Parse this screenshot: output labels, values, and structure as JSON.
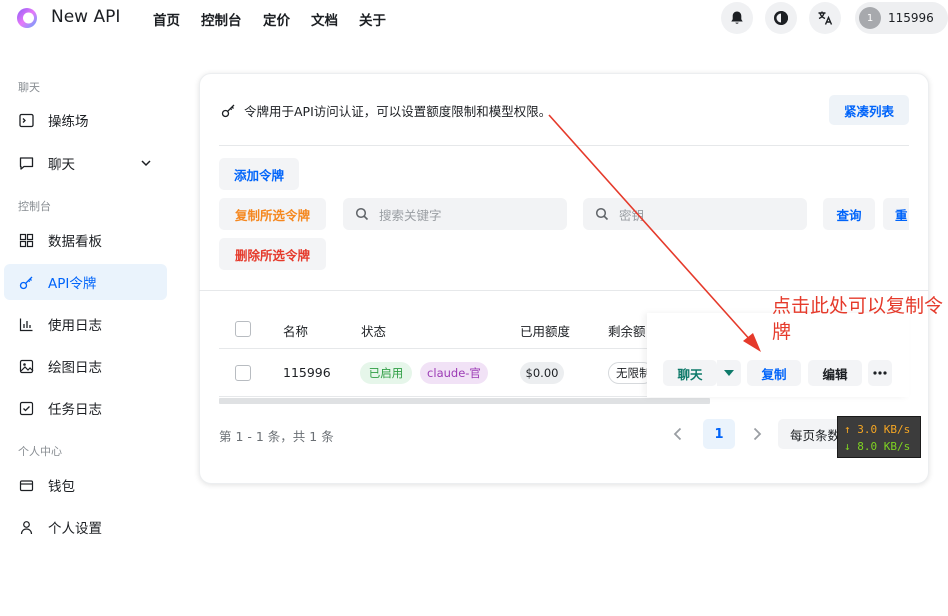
{
  "app": {
    "brand": "New API"
  },
  "nav": [
    "首页",
    "控制台",
    "定价",
    "文档",
    "关于"
  ],
  "topbar": {
    "icons": [
      "bell-icon",
      "theme-moon-icon",
      "language-translate-icon"
    ],
    "user": {
      "avatar_text": "1",
      "name": "115996"
    }
  },
  "sidebar": {
    "sections": [
      {
        "label": "聊天"
      },
      {
        "label": "控制台"
      },
      {
        "label": "个人中心"
      }
    ],
    "items": [
      {
        "label": "操练场",
        "icon": "terminal-icon"
      },
      {
        "label": "聊天",
        "icon": "chat-bubble-icon"
      },
      {
        "label": "数据看板",
        "icon": "dashboard-grid-icon"
      },
      {
        "label": "API令牌",
        "icon": "key-icon",
        "active": true
      },
      {
        "label": "使用日志",
        "icon": "bar-chart-icon"
      },
      {
        "label": "绘图日志",
        "icon": "image-icon"
      },
      {
        "label": "任务日志",
        "icon": "checklist-icon"
      },
      {
        "label": "钱包",
        "icon": "wallet-icon"
      },
      {
        "label": "个人设置",
        "icon": "user-icon"
      }
    ]
  },
  "main": {
    "info": "令牌用于API访问认证，可以设置额度限制和模型权限。",
    "compact_label": "紧凑列表",
    "add_token": "添加令牌",
    "copy_selected": "复制所选令牌",
    "delete_selected": "删除所选令牌",
    "search_keyword_placeholder": "搜索关键字",
    "search_key_placeholder": "密钥",
    "query": "查询",
    "reset": "重",
    "columns": [
      "名称",
      "状态",
      "已用额度",
      "剩余额"
    ],
    "rows": [
      {
        "name": "115996",
        "status": "已启用",
        "model": "claude-官",
        "used": "$0.00",
        "remaining": "无限制"
      }
    ],
    "row_actions": {
      "chat": "聊天",
      "copy": "复制",
      "edit": "编辑"
    },
    "pagination": {
      "summary": "第 1 - 1 条，共 1 条",
      "current": "1",
      "per_page": "每页条数:"
    }
  },
  "speed": {
    "up": "↑ 3.0 KB/s",
    "down": "↓ 8.0 KB/s"
  },
  "annotation": {
    "text": "点击此处可以复制令牌"
  },
  "colors": {
    "accent": "#0064fa",
    "orange": "#f5871f",
    "red": "#e53a2b",
    "green": "#2f9e44"
  }
}
